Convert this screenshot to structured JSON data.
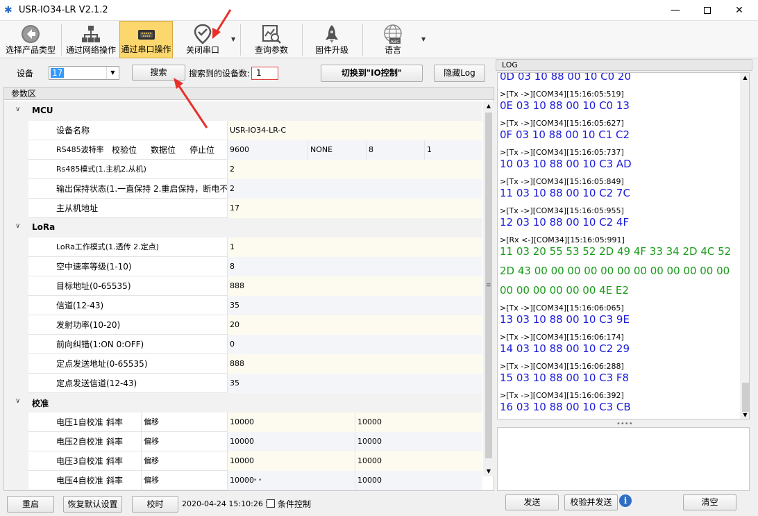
{
  "window": {
    "title": "USR-IO34-LR V2.1.2",
    "minimize": "—",
    "close": "✕"
  },
  "toolbar": {
    "items": [
      {
        "label": "选择产品类型",
        "icon": "back-arrow-icon"
      },
      {
        "label": "通过网络操作",
        "icon": "network-icon"
      },
      {
        "label": "通过串口操作",
        "icon": "serial-port-icon"
      },
      {
        "label": "关闭串口",
        "icon": "check-location-icon"
      },
      {
        "label": "查询参数",
        "icon": "query-chart-icon"
      },
      {
        "label": "固件升级",
        "icon": "rocket-icon"
      },
      {
        "label": "语言",
        "icon": "globe-abc-icon"
      }
    ],
    "active_index": 2,
    "globe_badge": "ABC"
  },
  "device_bar": {
    "device_label": "设备",
    "device_value": "17",
    "search_button": "搜索",
    "search_count_label": "搜索到的设备数:",
    "search_count": "1",
    "switch_button": "切换到\"IO控制\"",
    "hide_log_button": "隐藏Log"
  },
  "params": {
    "header": "参数区",
    "mcu": {
      "name": "MCU",
      "device_name_label": "设备名称",
      "device_name_value": "USR-IO34-LR-C",
      "rs485_cols": [
        "RS485波特率",
        "校验位",
        "数据位",
        "停止位"
      ],
      "rs485_vals": [
        "9600",
        "NONE",
        "8",
        "1"
      ],
      "rs485_mode_label": "Rs485模式(1.主机2.从机)",
      "rs485_mode_value": "2",
      "output_hold_label": "输出保持状态(1.一直保持 2.重启保持，断电不",
      "output_hold_value": "2",
      "master_slave_label": "主从机地址",
      "master_slave_value": "17"
    },
    "lora": {
      "name": "LoRa",
      "rows": [
        {
          "label": "LoRa工作模式(1.透传 2.定点)",
          "value": "1"
        },
        {
          "label": "空中速率等级(1-10)",
          "value": "8"
        },
        {
          "label": "目标地址(0-65535)",
          "value": "888"
        },
        {
          "label": "信道(12-43)",
          "value": "35"
        },
        {
          "label": "发射功率(10-20)",
          "value": "20"
        },
        {
          "label": "前向纠错(1:ON 0:OFF)",
          "value": "0"
        },
        {
          "label": "定点发送地址(0-65535)",
          "value": "888"
        },
        {
          "label": "定点发送信道(12-43)",
          "value": "35"
        }
      ]
    },
    "calib": {
      "name": "校准",
      "slope": "斜率",
      "offset": "偏移",
      "rows": [
        {
          "label": "电压1自校准",
          "v1": "10000",
          "v2": "10000"
        },
        {
          "label": "电压2自校准",
          "v1": "10000",
          "v2": "10000"
        },
        {
          "label": "电压3自校准",
          "v1": "10000",
          "v2": "10000"
        },
        {
          "label": "电压4自校准",
          "v1": "10000",
          "v2": "10000"
        }
      ]
    }
  },
  "bottom_bar": {
    "restart": "重启",
    "restore": "恢复默认设置",
    "sync_time": "校时",
    "datetime": "2020-04-24 15:10:26 5",
    "conditional_label": "条件控制"
  },
  "log": {
    "header": "LOG",
    "lines": [
      {
        "kind": "tx",
        "text": "0D 03 10 88 00 10 C0 20"
      },
      {
        "kind": "meta",
        "text": ">[Tx ->][COM34][15:16:05:519]"
      },
      {
        "kind": "tx",
        "text": "0E 03 10 88 00 10 C0 13"
      },
      {
        "kind": "meta",
        "text": ">[Tx ->][COM34][15:16:05:627]"
      },
      {
        "kind": "tx",
        "text": "0F 03 10 88 00 10 C1 C2"
      },
      {
        "kind": "meta",
        "text": ">[Tx ->][COM34][15:16:05:737]"
      },
      {
        "kind": "tx",
        "text": "10 03 10 88 00 10 C3 AD"
      },
      {
        "kind": "meta",
        "text": ">[Tx ->][COM34][15:16:05:849]"
      },
      {
        "kind": "tx",
        "text": "11 03 10 88 00 10 C2 7C"
      },
      {
        "kind": "meta",
        "text": ">[Tx ->][COM34][15:16:05:955]"
      },
      {
        "kind": "tx",
        "text": "12 03 10 88 00 10 C2 4F"
      },
      {
        "kind": "meta",
        "text": ">[Rx <-][COM34][15:16:05:991]"
      },
      {
        "kind": "rx",
        "text": "11 03 20 55 53 52 2D 49 4F 33 34 2D 4C 52"
      },
      {
        "kind": "rx",
        "text": "2D 43 00 00 00 00 00 00 00 00 00 00 00 00"
      },
      {
        "kind": "rx",
        "text": "00 00 00 00 00 00 4E E2"
      },
      {
        "kind": "meta",
        "text": ">[Tx ->][COM34][15:16:06:065]"
      },
      {
        "kind": "tx",
        "text": "13 03 10 88 00 10 C3 9E"
      },
      {
        "kind": "meta",
        "text": ">[Tx ->][COM34][15:16:06:174]"
      },
      {
        "kind": "tx",
        "text": "14 03 10 88 00 10 C2 29"
      },
      {
        "kind": "meta",
        "text": ">[Tx ->][COM34][15:16:06:288]"
      },
      {
        "kind": "tx",
        "text": "15 03 10 88 00 10 C3 F8"
      },
      {
        "kind": "meta",
        "text": ">[Tx ->][COM34][15:16:06:392]"
      },
      {
        "kind": "tx",
        "text": "16 03 10 88 00 10 C3 CB"
      }
    ],
    "send_button": "发送",
    "check_send_button": "校验并发送",
    "clear_button": "清空"
  },
  "colors": {
    "tx_text": "#1b1bd8",
    "rx_text": "#1a9a1a",
    "active_tab": "#fbd76e",
    "annotation_arrow": "#e8302a"
  }
}
